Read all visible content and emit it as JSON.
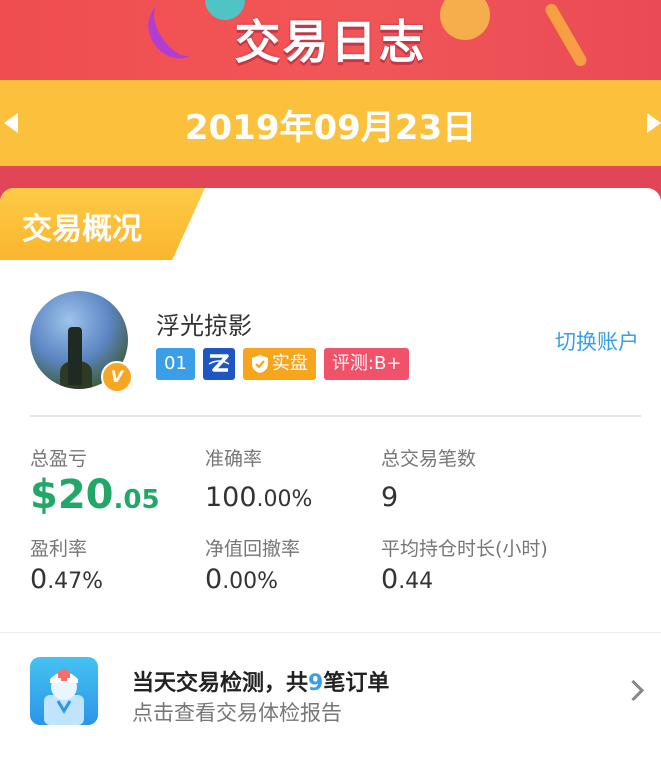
{
  "header": {
    "title": "交易日志"
  },
  "date_bar": {
    "date": "2019年09月23日"
  },
  "section": {
    "title": "交易概况"
  },
  "profile": {
    "username": "浮光掠影",
    "badge_number": "01",
    "badge_real": "实盘",
    "badge_eval": "评测:B+",
    "verified_mark": "V",
    "switch_account": "切换账户"
  },
  "stats": {
    "total_pnl_label": "总盈亏",
    "total_pnl_main": "$20",
    "total_pnl_dec": ".05",
    "accuracy_label": "准确率",
    "accuracy_main": "100",
    "accuracy_dec": ".00%",
    "trades_label": "总交易笔数",
    "trades_value": "9",
    "profit_rate_label": "盈利率",
    "profit_rate_main": "0",
    "profit_rate_dec": ".47%",
    "drawdown_label": "净值回撤率",
    "drawdown_main": "0",
    "drawdown_dec": ".00%",
    "hold_label": "平均持仓时长(小时)",
    "hold_main": "0",
    "hold_dec": ".44"
  },
  "check": {
    "title_prefix": "当天交易检测，共",
    "count": "9",
    "title_suffix": "笔订单",
    "subtitle": "点击查看交易体检报告"
  },
  "colors": {
    "banner": "#ef4d50",
    "date_bar": "#fcc13c",
    "profit_green": "#21a868",
    "link_blue": "#3a9fe8"
  }
}
